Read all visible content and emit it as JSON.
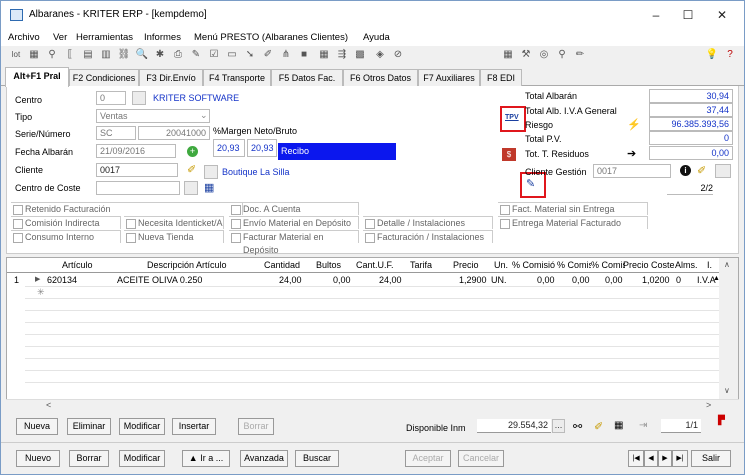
{
  "window": {
    "title": "Albaranes - KRITER ERP -  [kempdemo]",
    "minimize": "–",
    "maximize": "☐",
    "close": "✕"
  },
  "menu": [
    "Archivo",
    "Ver",
    "Herramientas",
    "Informes",
    "Menú PRESTO (Albaranes Clientes)",
    "Ayuda"
  ],
  "tabs": [
    "Alt+F1 Pral",
    "F2 Condiciones",
    "F3 Dir.Envío",
    "F4 Transporte",
    "F5 Datos Fac.",
    "F6 Otros Datos",
    "F7 Auxiliares",
    "F8 EDI"
  ],
  "form": {
    "centro_label": "Centro",
    "centro_value": "0",
    "centro_name": "KRITER SOFTWARE",
    "tipo_label": "Tipo",
    "tipo_value": "Ventas",
    "serie_label": "Serie/Número",
    "serie_value": "SC",
    "numero_value": "20041000",
    "fecha_label": "Fecha Albarán",
    "fecha_value": "21/09/2016",
    "cliente_label": "Cliente",
    "cliente_value": "0017",
    "cliente_name": "Boutique La Silla",
    "coste_label": "Centro de Coste",
    "margen_label": "%Margen Neto/Bruto",
    "margen_neto": "20,93",
    "margen_bruto": "20,93",
    "recibo": "Recibo",
    "tpv": "TPV",
    "total_albaran_label": "Total Albarán",
    "total_albaran": "30,94",
    "total_iva_label": "Total Alb. I.V.A General",
    "total_iva": "37,44",
    "riesgo_label": "Riesgo",
    "riesgo": "96.385.393,56",
    "total_pv_label": "Total P.V.",
    "total_pv": "0",
    "residuos_label": "Tot. T. Residuos",
    "residuos": "0,00",
    "gestion_label": "Cliente Gestión",
    "gestion_value": "0017",
    "pagina": "2/2"
  },
  "checks": {
    "retenido": "Retenido Facturación",
    "comision": "Comisión Indirecta",
    "consumo": "Consumo Interno",
    "ident": "Necesita Identicket/A",
    "tienda": "Nueva Tienda",
    "doc": "Doc. A Cuenta",
    "envio": "Envío Material en Depósito",
    "facturar": "Facturar Material en Depósito",
    "detalle": "Detalle / Instalaciones",
    "facinst": "Facturación / Instalaciones",
    "fact_sin": "Fact. Material sin Entrega",
    "entrega": "Entrega Material Facturado"
  },
  "grid": {
    "headers": [
      "Artículo",
      "Descripción Artículo",
      "Cantidad",
      "Bultos",
      "Cant.U.F.",
      "Tarifa",
      "Precio",
      "Un.",
      "% Comisió",
      "% Comis.",
      "% Comis.",
      "Precio Coste",
      "Alms.",
      "I."
    ],
    "row": {
      "num": "1",
      "articulo": "620134",
      "descripcion": "ACEITE OLIVA 0.250",
      "cantidad": "24,00",
      "bultos": "0,00",
      "cantuf": "24,00",
      "tarifa": "",
      "precio": "1,2900",
      "un": "UN.",
      "c1": "0,00",
      "c2": "0,00",
      "c3": "0,00",
      "coste": "1,0200",
      "alms": "0",
      "iva": "I.V.A"
    }
  },
  "lines_bar": {
    "nueva": "Nueva",
    "eliminar": "Eliminar",
    "modificar": "Modificar",
    "insertar": "Insertar",
    "borrar": "Borrar",
    "disponible_label": "Disponible Inm",
    "disponible": "29.554,32",
    "paginas": "1/1"
  },
  "bottom_bar": {
    "nuevo": "Nuevo",
    "borrar": "Borrar",
    "modificar": "Modificar",
    "ir": "▲ Ir a ...",
    "avanzada": "Avanzada",
    "buscar": "Buscar",
    "aceptar": "Aceptar",
    "cancelar": "Cancelar",
    "salir": "Salir"
  }
}
